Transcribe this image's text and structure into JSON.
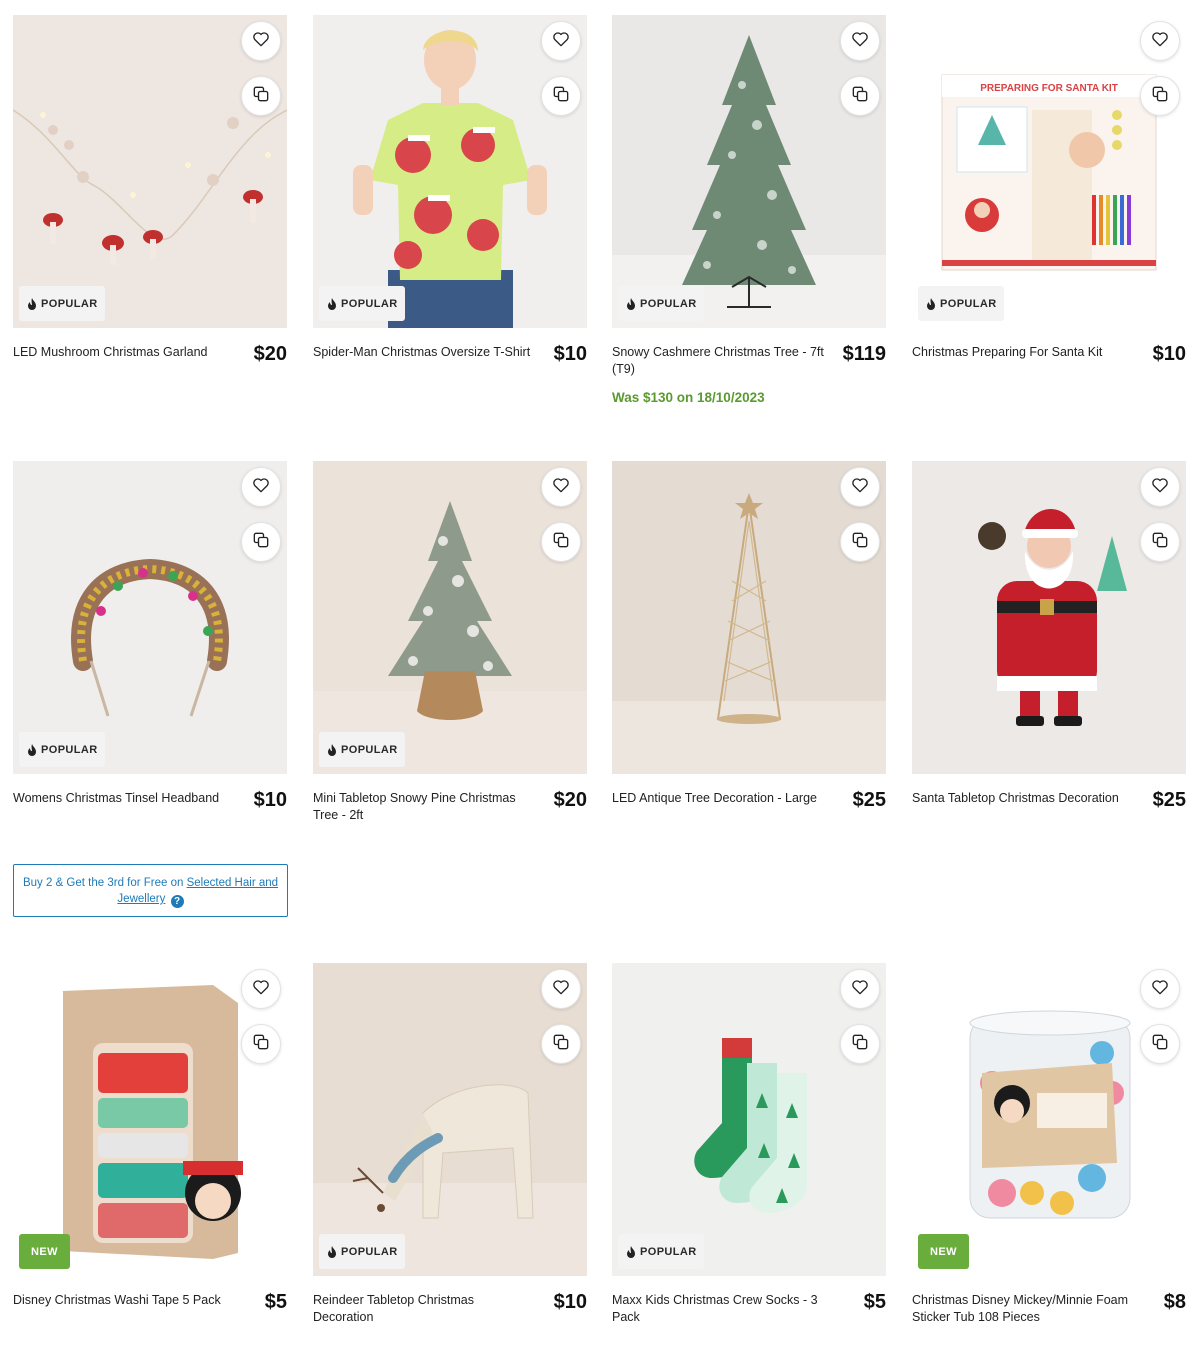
{
  "badges": {
    "popular": "POPULAR",
    "new": "NEW"
  },
  "colors": {
    "accent_green": "#69ad3c",
    "was_price_green": "#5a9a2e",
    "promo_blue": "#1e7bb8"
  },
  "icons": {
    "favourite": "heart-icon",
    "compare": "compare-icon",
    "popular": "flame-icon",
    "help": "question-icon"
  },
  "products": [
    {
      "title": "LED Mushroom Christmas Garland",
      "price": "$20",
      "badge": "POPULAR"
    },
    {
      "title": "Spider-Man Christmas Oversize T-Shirt",
      "price": "$10",
      "badge": "POPULAR"
    },
    {
      "title": "Snowy Cashmere Christmas Tree - 7ft (T9)",
      "price": "$119",
      "badge": "POPULAR",
      "was": "Was $130 on 18/10/2023"
    },
    {
      "title": "Christmas Preparing For Santa Kit",
      "price": "$10",
      "badge": "POPULAR",
      "image_text": "PREPARING FOR SANTA KIT"
    },
    {
      "title": "Womens Christmas Tinsel Headband",
      "price": "$10",
      "badge": "POPULAR"
    },
    {
      "title": "Mini Tabletop Snowy Pine Christmas Tree - 2ft",
      "price": "$20",
      "badge": "POPULAR"
    },
    {
      "title": "LED Antique Tree Decoration - Large",
      "price": "$25"
    },
    {
      "title": "Santa Tabletop Christmas Decoration",
      "price": "$25"
    },
    {
      "title": "Disney Christmas Washi Tape 5 Pack",
      "price": "$5",
      "badge": "NEW"
    },
    {
      "title": "Reindeer Tabletop Christmas Decoration",
      "price": "$10",
      "badge": "POPULAR"
    },
    {
      "title": "Maxx Kids Christmas Crew Socks - 3 Pack",
      "price": "$5",
      "badge": "POPULAR"
    },
    {
      "title": "Christmas Disney Mickey/Minnie Foam Sticker Tub 108 Pieces",
      "price": "$8",
      "badge": "NEW"
    }
  ],
  "promo": {
    "text": "Buy 2 & Get the 3rd for Free on ",
    "link": "Selected Hair and Jewellery",
    "help": "?"
  }
}
